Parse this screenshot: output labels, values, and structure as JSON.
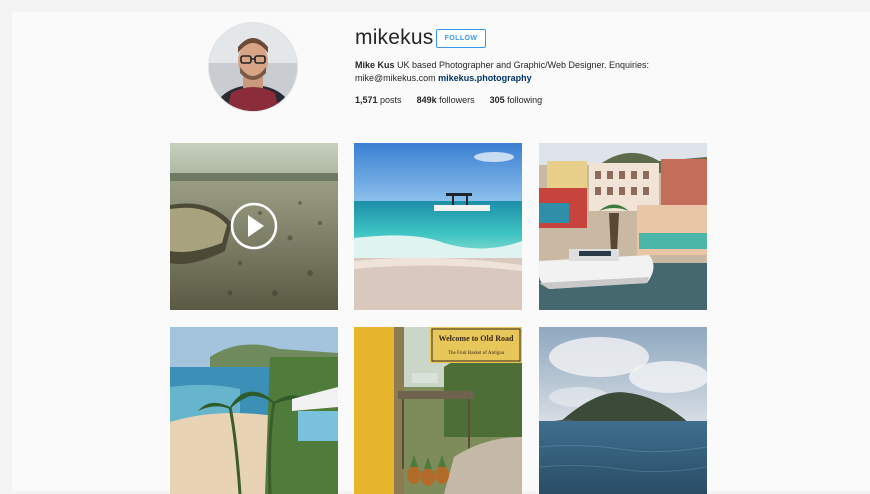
{
  "profile": {
    "username": "mikekus",
    "follow_label": "FOLLOW",
    "bio": {
      "name": "Mike Kus",
      "text": "UK based Photographer and Graphic/Web Designer. Enquiries:",
      "email": "mike@mikekus.com",
      "link": "mikekus.photography"
    },
    "stats": {
      "posts_count": "1,571",
      "posts_label": "posts",
      "followers_count": "849k",
      "followers_label": "followers",
      "following_count": "305",
      "following_label": "following"
    }
  },
  "grid": {
    "posts": [
      {
        "name": "beach-boat-video",
        "type": "video"
      },
      {
        "name": "turquoise-sea-boat",
        "type": "image"
      },
      {
        "name": "harbour-yacht-town",
        "type": "image"
      },
      {
        "name": "coast-palms",
        "type": "image"
      },
      {
        "name": "fruit-stand-sign",
        "type": "image",
        "sign_text": "Welcome to Old Road",
        "sign_subtext": "The Fruit Basket of Antigua"
      },
      {
        "name": "island-sea",
        "type": "image"
      }
    ]
  },
  "colors": {
    "link": "#003569",
    "follow_blue": "#3897f0"
  }
}
